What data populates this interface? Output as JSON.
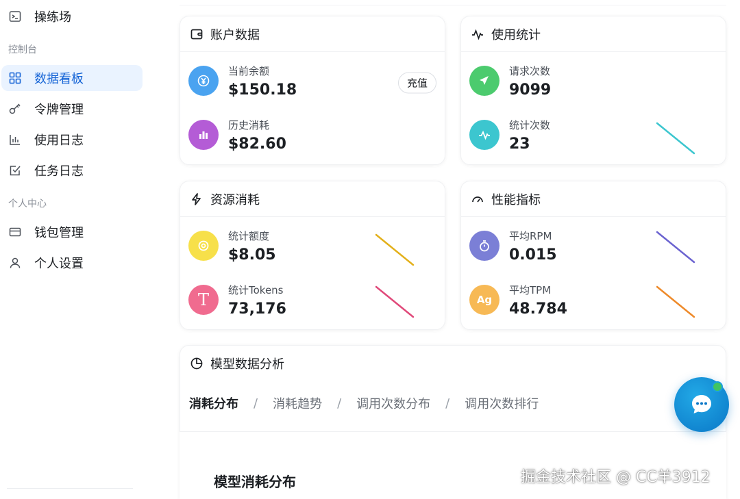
{
  "sidebar": {
    "playground": "操练场",
    "section_console": "控制台",
    "dashboard": "数据看板",
    "tokens": "令牌管理",
    "usage_log": "使用日志",
    "task_log": "任务日志",
    "section_personal": "个人中心",
    "wallet": "钱包管理",
    "settings": "个人设置"
  },
  "account": {
    "title": "账户数据",
    "balance_label": "当前余额",
    "balance_value": "$150.18",
    "recharge_label": "充值",
    "history_label": "历史消耗",
    "history_value": "$82.60"
  },
  "usage": {
    "title": "使用统计",
    "requests_label": "请求次数",
    "requests_value": "9099",
    "stat_count_label": "统计次数",
    "stat_count_value": "23"
  },
  "resource": {
    "title": "资源消耗",
    "quota_label": "统计额度",
    "quota_value": "$8.05",
    "tokens_label": "统计Tokens",
    "tokens_value": "73,176"
  },
  "performance": {
    "title": "性能指标",
    "rpm_label": "平均RPM",
    "rpm_value": "0.015",
    "tpm_label": "平均TPM",
    "tpm_value": "48.784"
  },
  "model_analysis": {
    "title": "模型数据分析",
    "tabs": [
      "消耗分布",
      "消耗趋势",
      "调用次数分布",
      "调用次数排行"
    ],
    "separator": "/",
    "inner_title": "模型消耗分布"
  },
  "icons": {
    "balance": "yen-circle-icon",
    "history": "bar-chart-icon",
    "requests": "send-icon",
    "stat_count": "pulse-icon",
    "quota": "coin-icon",
    "tokens_letter": "T",
    "rpm": "stopwatch-icon",
    "tpm_letter": "Ag"
  },
  "colors": {
    "accent": "#1463d6",
    "active_bg": "#eaf3ff",
    "balance": "#4aa3f0",
    "history": "#b45cd6",
    "requests": "#4ccb6e",
    "stat_count": "#3cc6cf",
    "quota": "#f7e04a",
    "tokens": "#f06b8f",
    "rpm": "#7b7fd6",
    "tpm": "#f7b955"
  },
  "watermark": "掘金技术社区 @ CC羊3912"
}
